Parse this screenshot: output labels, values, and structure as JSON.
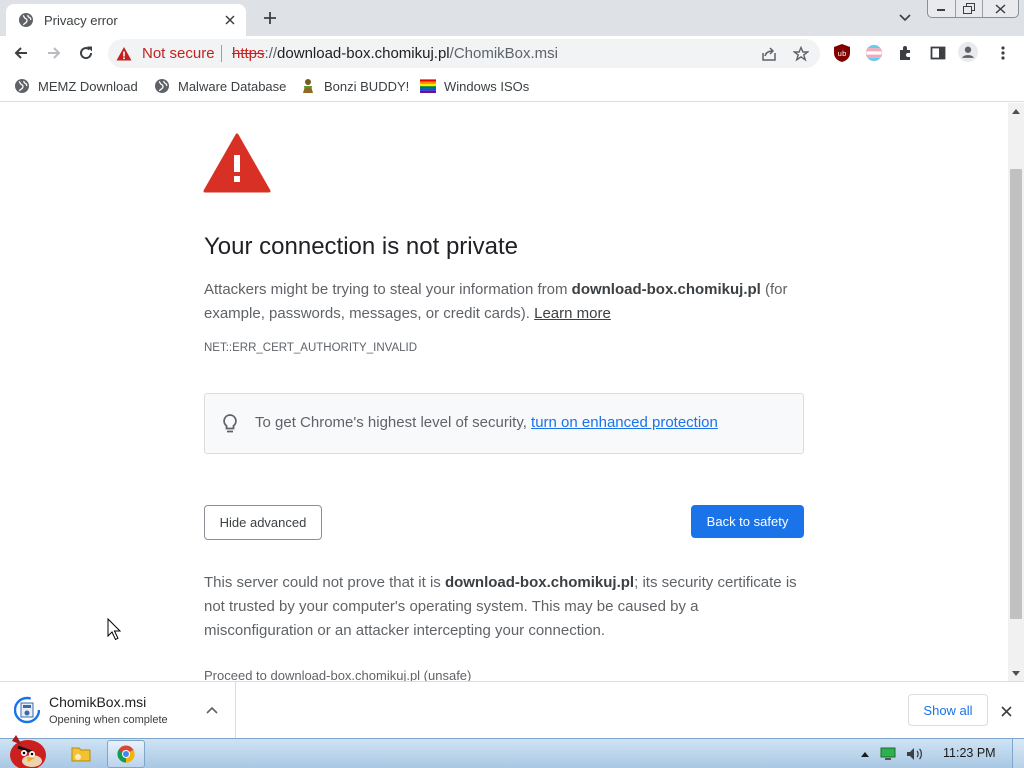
{
  "tab": {
    "title": "Privacy error"
  },
  "window_controls": {
    "minimize": "minimize",
    "restore": "restore",
    "close": "close"
  },
  "omnibox": {
    "security_label": "Not secure",
    "url_scheme": "https",
    "url_sep": "://",
    "url_host": "download-box.chomikuj.pl",
    "url_path": "/ChomikBox.msi"
  },
  "bookmarks": [
    {
      "label": "MEMZ Download",
      "icon": "globe-icon"
    },
    {
      "label": "Malware Database",
      "icon": "globe-icon"
    },
    {
      "label": "Bonzi BUDDY!",
      "icon": "bonzi-icon"
    },
    {
      "label": "Windows ISOs",
      "icon": "rainbow-flag-icon"
    }
  ],
  "page": {
    "heading": "Your connection is not private",
    "intro_before": "Attackers might be trying to steal your information from ",
    "host": "download-box.chomikuj.pl",
    "intro_after": " (for example, passwords, messages, or credit cards). ",
    "learn_more": "Learn more",
    "error_code": "NET::ERR_CERT_AUTHORITY_INVALID",
    "enhanced_text": "To get Chrome's highest level of security, ",
    "enhanced_link": "turn on enhanced protection",
    "hide_advanced": "Hide advanced",
    "back_to_safety": "Back to safety",
    "detail_before": "This server could not prove that it is ",
    "detail_after": "; its security certificate is not trusted by your computer's operating system. This may be caused by a misconfiguration or an attacker intercepting your connection.",
    "proceed_link": "Proceed to download-box.chomikuj.pl (unsafe)"
  },
  "download": {
    "filename": "ChomikBox.msi",
    "status": "Opening when complete",
    "show_all": "Show all"
  },
  "taskbar": {
    "clock": "11:23 PM"
  },
  "colors": {
    "accent": "#1a73e8",
    "danger": "#c5221f",
    "warning_red": "#d93025"
  }
}
